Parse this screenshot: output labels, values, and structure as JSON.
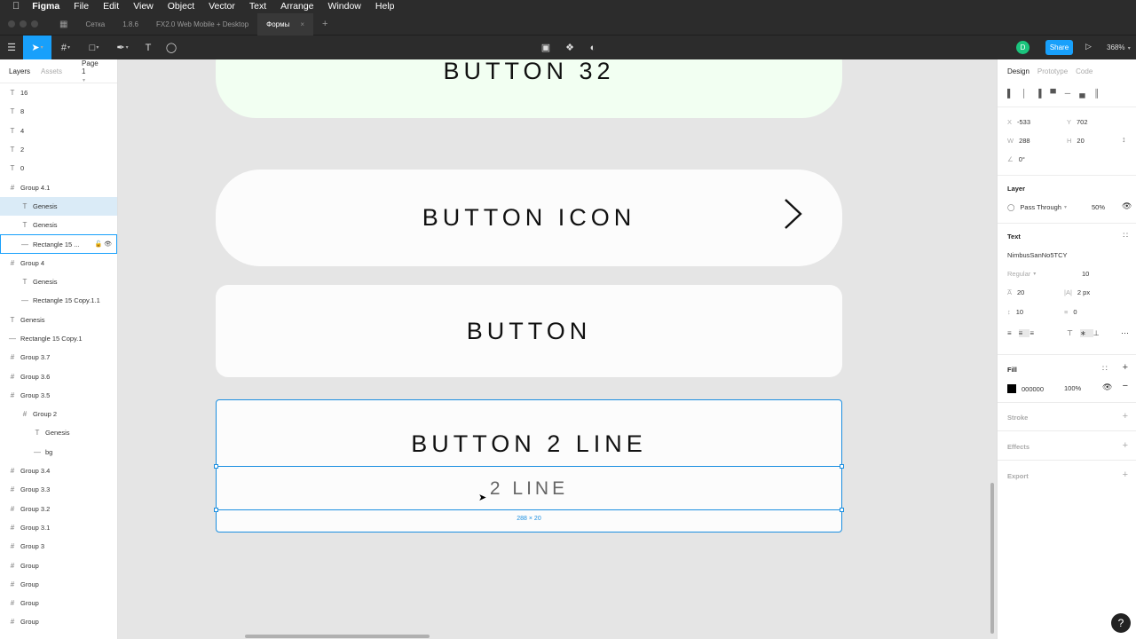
{
  "menubar": {
    "app": "Figma",
    "items": [
      "File",
      "Edit",
      "View",
      "Object",
      "Vector",
      "Text",
      "Arrange",
      "Window",
      "Help"
    ]
  },
  "tabs": [
    "Сетка",
    "1.8.6",
    "FX2.0 Web Mobile + Desktop",
    "Формы"
  ],
  "toolbar": {
    "user_initial": "D",
    "share_label": "Share",
    "zoom": "368%"
  },
  "left_panel": {
    "tabs": [
      "Layers",
      "Assets",
      "Page 1"
    ],
    "layers": [
      {
        "icon": "T",
        "name": "16",
        "indent": 0
      },
      {
        "icon": "T",
        "name": "8",
        "indent": 0
      },
      {
        "icon": "T",
        "name": "4",
        "indent": 0
      },
      {
        "icon": "T",
        "name": "2",
        "indent": 0
      },
      {
        "icon": "T",
        "name": "0",
        "indent": 0
      },
      {
        "icon": "#",
        "name": "Group 4.1",
        "indent": 0
      },
      {
        "icon": "T",
        "name": "Genesis",
        "indent": 1,
        "state": "hl"
      },
      {
        "icon": "T",
        "name": "Genesis",
        "indent": 1
      },
      {
        "icon": "—",
        "name": "Rectangle 15 ...",
        "indent": 1,
        "state": "sel"
      },
      {
        "icon": "#",
        "name": "Group 4",
        "indent": 0
      },
      {
        "icon": "T",
        "name": "Genesis",
        "indent": 1
      },
      {
        "icon": "—",
        "name": "Rectangle 15 Copy.1.1",
        "indent": 1
      },
      {
        "icon": "T",
        "name": "Genesis",
        "indent": 0
      },
      {
        "icon": "—",
        "name": "Rectangle 15 Copy.1",
        "indent": 0
      },
      {
        "icon": "#",
        "name": "Group 3.7",
        "indent": 0
      },
      {
        "icon": "#",
        "name": "Group 3.6",
        "indent": 0
      },
      {
        "icon": "#",
        "name": "Group 3.5",
        "indent": 0
      },
      {
        "icon": "#",
        "name": "Group 2",
        "indent": 1
      },
      {
        "icon": "T",
        "name": "Genesis",
        "indent": 2
      },
      {
        "icon": "—",
        "name": "bg",
        "indent": 2
      },
      {
        "icon": "#",
        "name": "Group 3.4",
        "indent": 0
      },
      {
        "icon": "#",
        "name": "Group 3.3",
        "indent": 0
      },
      {
        "icon": "#",
        "name": "Group 3.2",
        "indent": 0
      },
      {
        "icon": "#",
        "name": "Group 3.1",
        "indent": 0
      },
      {
        "icon": "#",
        "name": "Group 3",
        "indent": 0
      },
      {
        "icon": "#",
        "name": "Group",
        "indent": 0
      },
      {
        "icon": "#",
        "name": "Group",
        "indent": 0
      },
      {
        "icon": "#",
        "name": "Group",
        "indent": 0
      },
      {
        "icon": "#",
        "name": "Group",
        "indent": 0
      }
    ]
  },
  "canvas": {
    "button32": "BUTTON 32",
    "button_icon": "BUTTON ICON",
    "button": "BUTTON",
    "button2_line1": "BUTTON 2 LINE",
    "button2_line2": "2 LINE",
    "dimensions": "288 × 20"
  },
  "right_panel": {
    "tabs": [
      "Design",
      "Prototype",
      "Code"
    ],
    "x_label": "X",
    "x": "-533",
    "y_label": "Y",
    "y": "702",
    "w_label": "W",
    "w": "288",
    "h_label": "H",
    "h": "20",
    "rotation": "0°",
    "layer_title": "Layer",
    "blend": "Pass Through",
    "opacity": "50%",
    "text_title": "Text",
    "font": "NimbusSanNo5TCY",
    "weight": "Regular",
    "size": "10",
    "line_height": "20",
    "letter_spacing": "2 px",
    "para_spacing": "10",
    "para_indent": "0",
    "fill_title": "Fill",
    "fill_hex": "000000",
    "fill_opacity": "100%",
    "stroke_title": "Stroke",
    "effects_title": "Effects",
    "export_title": "Export"
  },
  "colors": {
    "accent": "#18a0fb",
    "selection": "#1a8ee0",
    "share": "#18a0fb",
    "avatar": "#1bc47d"
  }
}
